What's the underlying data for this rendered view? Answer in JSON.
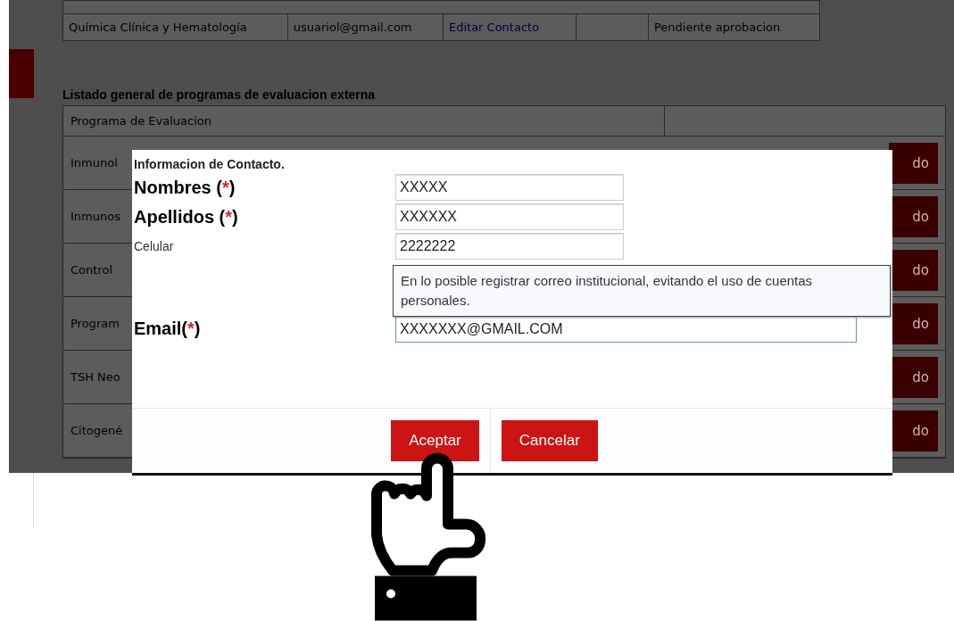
{
  "contact_table": {
    "rows": [
      {
        "program": "Química Clínica y Hematología",
        "email": "usuariol@gmail.com",
        "action": "Editar Contacto",
        "status": "Pendiente aprobacion"
      }
    ]
  },
  "section_title": "Listado general de programas de evaluacion externa",
  "programs_table": {
    "header": "Programa de Evaluacion",
    "rows": [
      {
        "name": "Inmunol",
        "button": "do"
      },
      {
        "name": "Inmunos",
        "button": "do"
      },
      {
        "name": "Control",
        "button": "do"
      },
      {
        "name": "Program",
        "button": "do"
      },
      {
        "name": "TSH Neo",
        "button": "do"
      },
      {
        "name": "Citogené",
        "button": "do"
      }
    ]
  },
  "dialog": {
    "title": "Informacion de Contacto.",
    "fields": [
      {
        "kind": "required",
        "label": "Nombres (",
        "mark": "*",
        "label_end": ")",
        "value": "XXXXX",
        "focused": false
      },
      {
        "kind": "required",
        "label": "Apellidos (",
        "mark": "*",
        "label_end": ")",
        "value": "XXXXXX",
        "focused": false
      },
      {
        "kind": "plain",
        "label": "Celular",
        "value": "2222222",
        "focused": false
      },
      {
        "kind": "required",
        "label": "Email(",
        "mark": "*",
        "label_end": ")",
        "value": "XXXXXXX@GMAIL.COM",
        "focused": true,
        "hint": "En lo posible registrar correo institucional, evitando el uso de cuentas personales."
      }
    ],
    "buttons": [
      "Aceptar",
      "Cancelar"
    ]
  }
}
